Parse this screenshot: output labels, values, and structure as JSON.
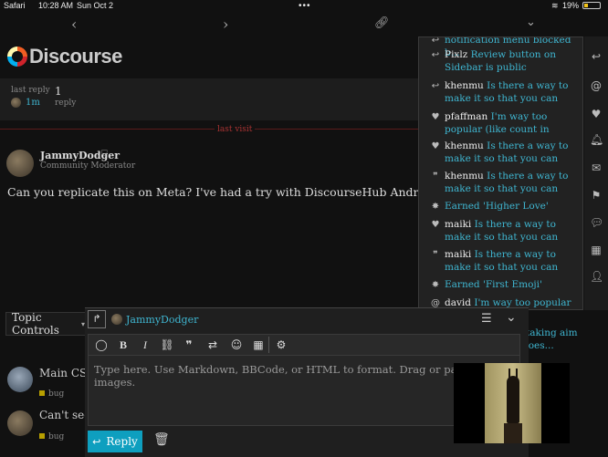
{
  "status": {
    "carrier": "Safari",
    "time": "10:28 AM",
    "date": "Sun Oct 2",
    "battery": "19%"
  },
  "logo_text": "Discourse",
  "topic_map": {
    "last_reply_label": "last reply",
    "last_reply_time": "1m",
    "replies_count": "1",
    "replies_label": "reply"
  },
  "last_visit": "last visit",
  "post": {
    "author": "JammyDodger",
    "role": "Community Moderator",
    "text": "Can you replicate this on Meta? I've had a try with DiscourseHub Android and iPhone a"
  },
  "topic_controls": "Topic Controls",
  "suggested": [
    {
      "title": "Main CSS",
      "tag": "bug"
    },
    {
      "title": "Can't see",
      "tag": "bug"
    }
  ],
  "notifications": [
    {
      "icon": "reply",
      "user": "",
      "title": "notification menu blocked b..."
    },
    {
      "icon": "reply",
      "user": "Pixlz",
      "title": "Review button on Sidebar is public"
    },
    {
      "icon": "reply",
      "user": "khenmu",
      "title": "Is there a way to make it so that you can mak..."
    },
    {
      "icon": "heart",
      "user": "pfaffman",
      "title": "I'm way too popular (like count in notification..."
    },
    {
      "icon": "heart",
      "user": "khenmu",
      "title": "Is there a way to make it so that you can mak..."
    },
    {
      "icon": "quote",
      "user": "khenmu",
      "title": "Is there a way to make it so that you can mak..."
    },
    {
      "icon": "badge",
      "user": "",
      "title": "Earned 'Higher Love'"
    },
    {
      "icon": "heart",
      "user": "maiki",
      "title": "Is there a way to make it so that you can make your..."
    },
    {
      "icon": "quote",
      "user": "maiki",
      "title": "Is there a way to make it so that you can make your..."
    },
    {
      "icon": "badge",
      "user": "",
      "title": "Earned 'First Emoji'"
    },
    {
      "icon": "at",
      "user": "david",
      "title": "I'm way too popular (like count in notification..."
    }
  ],
  "composer": {
    "reply_to": "JammyDodger",
    "placeholder": "Type here. Use Markdown, BBCode, or HTML to format. Drag or paste images.",
    "reply_button": "Reply",
    "behind_text": [
      "taking aim",
      "does..."
    ]
  }
}
